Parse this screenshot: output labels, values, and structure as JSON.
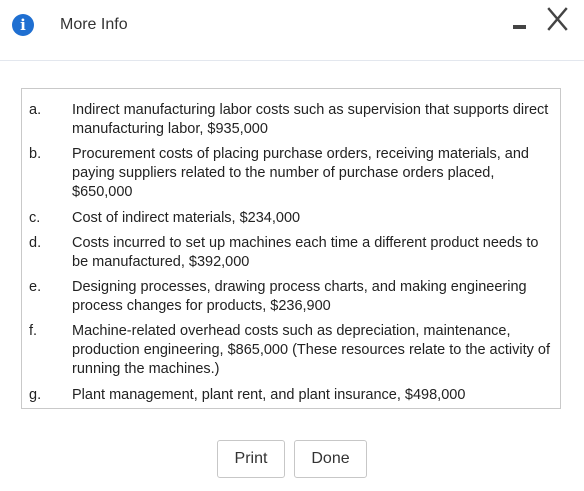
{
  "dialog": {
    "title": "More Info",
    "info_icon_glyph": "i",
    "accent_color": "#1f6fd1"
  },
  "items": [
    {
      "letter": "a.",
      "text": "Indirect manufacturing labor costs such as supervision that supports direct manufacturing labor, $935,000"
    },
    {
      "letter": "b.",
      "text": "Procurement costs of placing purchase orders, receiving materials, and paying suppliers related to the number of purchase orders placed, $650,000"
    },
    {
      "letter": "c.",
      "text": "Cost of indirect materials, $234,000"
    },
    {
      "letter": "d.",
      "text": "Costs incurred to set up machines each time a different product needs to be manufactured, $392,000"
    },
    {
      "letter": "e.",
      "text": "Designing processes, drawing process charts, and making engineering process changes for products, $236,900"
    },
    {
      "letter": "f.",
      "text": "Machine-related overhead costs such as depreciation, maintenance, production engineering, $865,000 (These resources relate to the activity of running the machines.)"
    },
    {
      "letter": "g.",
      "text": "Plant management, plant rent, and plant insurance, $498,000"
    }
  ],
  "buttons": {
    "print_label": "Print",
    "done_label": "Done"
  }
}
